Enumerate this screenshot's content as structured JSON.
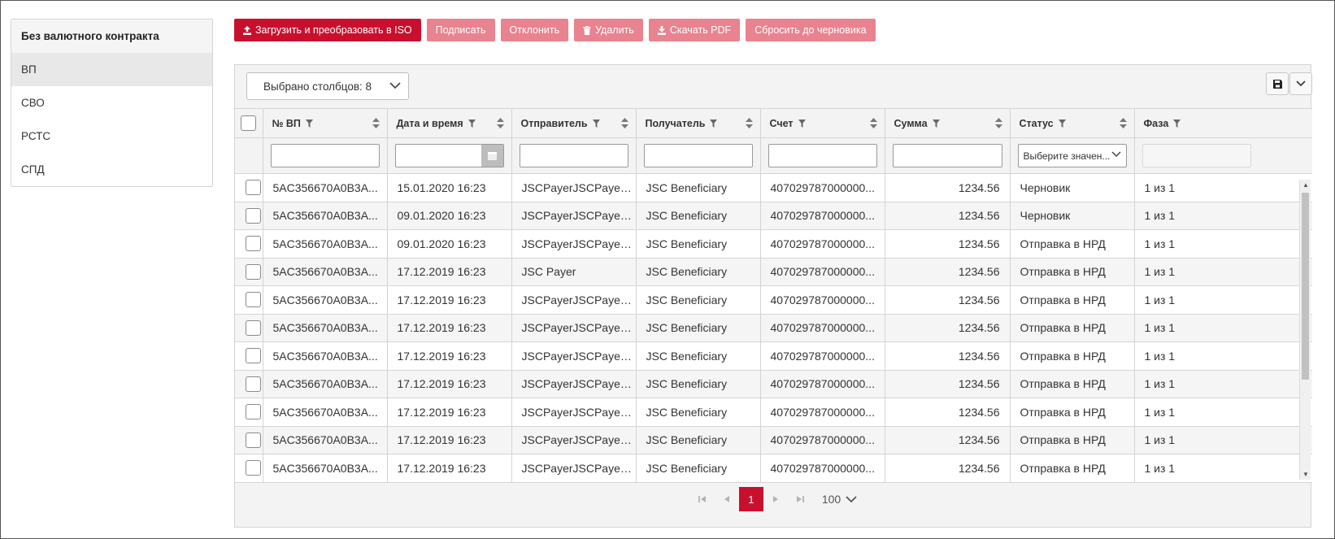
{
  "nav": {
    "header": "Без валютного контракта",
    "items": [
      {
        "label": "ВП",
        "active": true
      },
      {
        "label": "СВО",
        "active": false
      },
      {
        "label": "РСТС",
        "active": false
      },
      {
        "label": "СПД",
        "active": false
      }
    ]
  },
  "toolbar": {
    "upload_label": "Загрузить и преобразовать в ISO",
    "sign_label": "Подписать",
    "reject_label": "Отклонить",
    "delete_label": "Удалить",
    "download_pdf_label": "Скачать PDF",
    "reset_label": "Сбросить до черновика"
  },
  "grid": {
    "columns_selector": "Выбрано столбцов: 8",
    "columns": [
      "№ ВП",
      "Дата и время",
      "Отправитель",
      "Получатель",
      "Счет",
      "Сумма",
      "Статус",
      "Фаза"
    ],
    "status_filter_placeholder": "Выберите значен...",
    "rows": [
      [
        "5AC356670A0B3A...",
        "15.01.2020 16:23",
        "JSCPayerJSCPayerJ...",
        "JSC Beneficiary",
        "407029787000000...",
        "1234.56",
        "Черновик",
        "1 из 1"
      ],
      [
        "5AC356670A0B3A...",
        "09.01.2020 16:23",
        "JSCPayerJSCPayerJ...",
        "JSC Beneficiary",
        "407029787000000...",
        "1234.56",
        "Черновик",
        "1 из 1"
      ],
      [
        "5AC356670A0B3A...",
        "09.01.2020 16:23",
        "JSCPayerJSCPayerJ...",
        "JSC Beneficiary",
        "407029787000000...",
        "1234.56",
        "Отправка в НРД",
        "1 из 1"
      ],
      [
        "5AC356670A0B3A...",
        "17.12.2019 16:23",
        "JSC Payer",
        "JSC Beneficiary",
        "407029787000000...",
        "1234.56",
        "Отправка в НРД",
        "1 из 1"
      ],
      [
        "5AC356670A0B3A...",
        "17.12.2019 16:23",
        "JSCPayerJSCPayerJ...",
        "JSC Beneficiary",
        "407029787000000...",
        "1234.56",
        "Отправка в НРД",
        "1 из 1"
      ],
      [
        "5AC356670A0B3A...",
        "17.12.2019 16:23",
        "JSCPayerJSCPayerJ...",
        "JSC Beneficiary",
        "407029787000000...",
        "1234.56",
        "Отправка в НРД",
        "1 из 1"
      ],
      [
        "5AC356670A0B3A...",
        "17.12.2019 16:23",
        "JSCPayerJSCPayerJ...",
        "JSC Beneficiary",
        "407029787000000...",
        "1234.56",
        "Отправка в НРД",
        "1 из 1"
      ],
      [
        "5AC356670A0B3A...",
        "17.12.2019 16:23",
        "JSCPayerJSCPayerJ...",
        "JSC Beneficiary",
        "407029787000000...",
        "1234.56",
        "Отправка в НРД",
        "1 из 1"
      ],
      [
        "5AC356670A0B3A...",
        "17.12.2019 16:23",
        "JSCPayerJSCPayerJ...",
        "JSC Beneficiary",
        "407029787000000...",
        "1234.56",
        "Отправка в НРД",
        "1 из 1"
      ],
      [
        "5AC356670A0B3A...",
        "17.12.2019 16:23",
        "JSCPayerJSCPayerJ...",
        "JSC Beneficiary",
        "407029787000000...",
        "1234.56",
        "Отправка в НРД",
        "1 из 1"
      ],
      [
        "5AC356670A0B3A...",
        "17.12.2019 16:23",
        "JSCPayerJSCPayerJ...",
        "JSC Beneficiary",
        "407029787000000...",
        "1234.56",
        "Отправка в НРД",
        "1 из 1"
      ]
    ]
  },
  "pager": {
    "current_page": "1",
    "page_size": "100"
  },
  "colors": {
    "accent": "#c8102e",
    "accent_disabled": "#e9838f"
  }
}
